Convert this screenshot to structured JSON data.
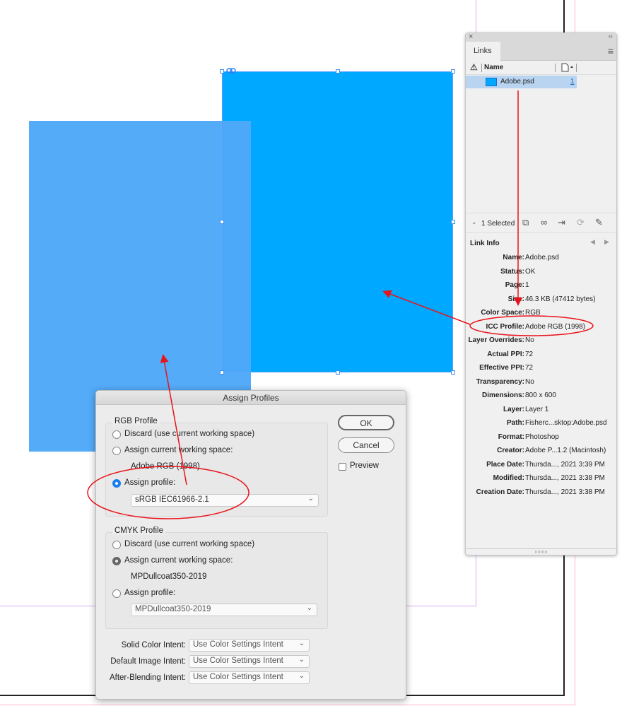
{
  "canvas": {
    "left_rect_color": "#4ea8f8",
    "right_rect_color": "#00a8ff",
    "annotation_color": "#e8141b"
  },
  "links_panel": {
    "close_icon": "×",
    "collapse_icon": "‹‹",
    "tab": "Links",
    "menu_icon": "≡",
    "columns": {
      "warning": "⚠",
      "name": "Name",
      "page": "page-icon"
    },
    "rows": [
      {
        "name": "Adobe.psd",
        "page": "1"
      }
    ],
    "selected_count": "1 Selected",
    "link_info_title": "Link Info",
    "info": [
      {
        "key": "Name:",
        "value": "Adobe.psd"
      },
      {
        "key": "Status:",
        "value": "OK"
      },
      {
        "key": "Page:",
        "value": "1"
      },
      {
        "key": "Size:",
        "value": "46.3 KB (47412 bytes)"
      },
      {
        "key": "Color Space:",
        "value": "RGB"
      },
      {
        "key": "ICC Profile:",
        "value": "Adobe RGB (1998)"
      },
      {
        "key": "Layer Overrides:",
        "value": "No"
      },
      {
        "key": "Actual PPI:",
        "value": "72"
      },
      {
        "key": "Effective PPI:",
        "value": "72"
      },
      {
        "key": "Transparency:",
        "value": "No"
      },
      {
        "key": "Dimensions:",
        "value": "800 x 600"
      },
      {
        "key": "Layer:",
        "value": "Layer 1"
      },
      {
        "key": "Path:",
        "value": "Fisherc...sktop:Adobe.psd"
      },
      {
        "key": "Format:",
        "value": "Photoshop"
      },
      {
        "key": "Creator:",
        "value": "Adobe P...1.2 (Macintosh)"
      },
      {
        "key": "Place Date:",
        "value": "Thursda..., 2021 3:39 PM"
      },
      {
        "key": "Modified:",
        "value": "Thursda..., 2021 3:38 PM"
      },
      {
        "key": "Creation Date:",
        "value": "Thursda..., 2021 3:38 PM"
      }
    ]
  },
  "dialog": {
    "title": "Assign Profiles",
    "ok": "OK",
    "cancel": "Cancel",
    "preview": "Preview",
    "rgb": {
      "label": "RGB Profile",
      "discard": "Discard (use current working space)",
      "assign_current": "Assign current working space:",
      "current_space": "Adobe RGB (1998)",
      "assign_profile": "Assign profile:",
      "profile_value": "sRGB IEC61966-2.1",
      "selected": "assign_profile"
    },
    "cmyk": {
      "label": "CMYK Profile",
      "discard": "Discard (use current working space)",
      "assign_current": "Assign current working space:",
      "current_space": "MPDullcoat350-2019",
      "assign_profile": "Assign profile:",
      "profile_value": "MPDullcoat350-2019",
      "selected": "assign_current"
    },
    "intents": [
      {
        "label": "Solid Color Intent:",
        "value": "Use Color Settings Intent"
      },
      {
        "label": "Default Image Intent:",
        "value": "Use Color Settings Intent"
      },
      {
        "label": "After-Blending Intent:",
        "value": "Use Color Settings Intent"
      }
    ]
  }
}
